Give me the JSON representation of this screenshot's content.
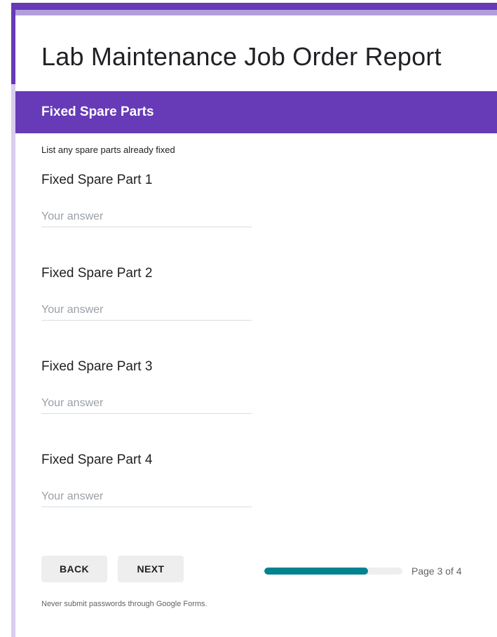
{
  "form": {
    "title": "Lab Maintenance Job Order Report"
  },
  "section": {
    "title": "Fixed Spare Parts",
    "description": "List any spare parts already fixed"
  },
  "questions": [
    {
      "label": "Fixed Spare Part 1",
      "placeholder": "Your answer",
      "value": ""
    },
    {
      "label": "Fixed Spare Part 2",
      "placeholder": "Your answer",
      "value": ""
    },
    {
      "label": "Fixed Spare Part 3",
      "placeholder": "Your answer",
      "value": ""
    },
    {
      "label": "Fixed Spare Part 4",
      "placeholder": "Your answer",
      "value": ""
    }
  ],
  "nav": {
    "back_label": "BACK",
    "next_label": "NEXT"
  },
  "progress": {
    "current_page": 3,
    "total_pages": 4,
    "fraction": 0.75,
    "text": "Page 3 of 4"
  },
  "footer": {
    "note": "Never submit passwords through Google Forms."
  },
  "colors": {
    "theme": "#673ab7",
    "theme_light": "#b39ddb",
    "progress": "#00838f"
  }
}
